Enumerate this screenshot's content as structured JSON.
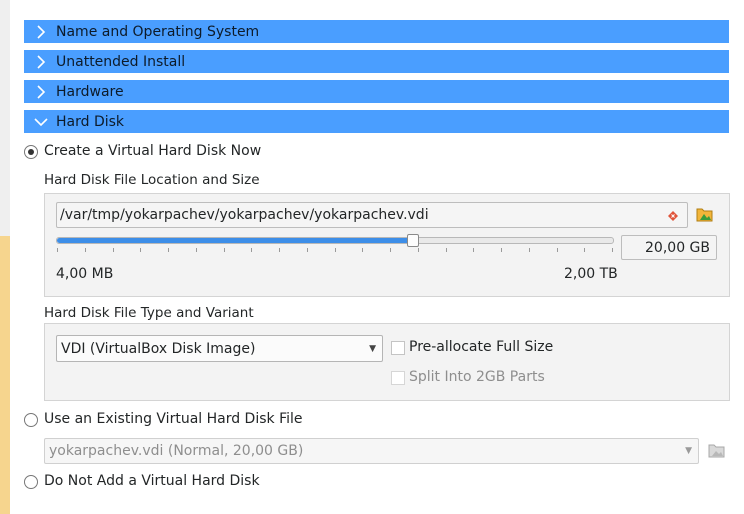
{
  "sections": [
    {
      "label": "Name and Operating System",
      "expanded": false
    },
    {
      "label": "Unattended Install",
      "expanded": false
    },
    {
      "label": "Hardware",
      "expanded": false
    },
    {
      "label": "Hard Disk",
      "expanded": true
    }
  ],
  "create_option": {
    "label": "Create a Virtual Hard Disk Now",
    "selected": true
  },
  "location_group": {
    "title": "Hard Disk File Location and Size",
    "path_value": "/var/tmp/yokarpachev/yokarpachev/yokarpachev.vdi",
    "size_value": "20,00 GB",
    "size_fraction": 0.64,
    "min_label": "4,00 MB",
    "max_label": "2,00 TB"
  },
  "type_group": {
    "title": "Hard Disk File Type and Variant",
    "type_value": "VDI (VirtualBox Disk Image)",
    "preallocate_label": "Pre-allocate Full Size",
    "split_label": "Split Into 2GB Parts"
  },
  "existing_option": {
    "label": "Use an Existing Virtual Hard Disk File",
    "selected": false,
    "value": "yokarpachev.vdi (Normal, 20,00 GB)"
  },
  "none_option": {
    "label": "Do Not Add a Virtual Hard Disk",
    "selected": false
  },
  "colors": {
    "section_bg": "#4a9eff",
    "slider_fill": "#3d8ee8"
  },
  "icons": [
    "chevron-right-icon",
    "chevron-down-icon",
    "clear-icon",
    "folder-open-icon",
    "folder-disabled-icon"
  ]
}
